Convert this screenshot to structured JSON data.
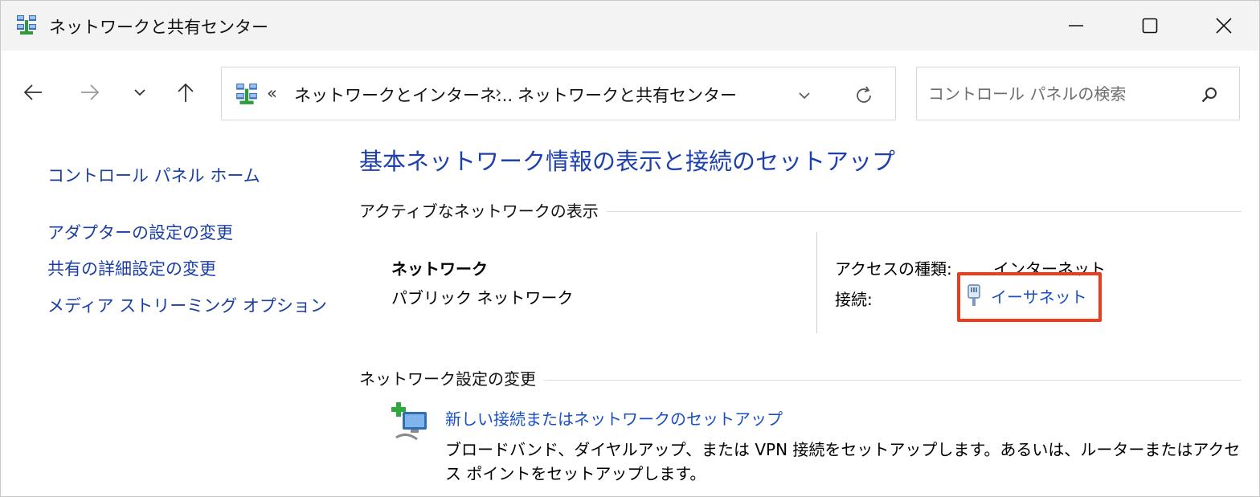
{
  "window": {
    "title": "ネットワークと共有センター",
    "icon": "network-center-icon"
  },
  "nav": {
    "back_icon": "arrow-left-icon",
    "forward_icon": "arrow-right-icon",
    "recent_icon": "chevron-down-icon",
    "up_icon": "arrow-up-icon"
  },
  "address": {
    "overflow": "«",
    "crumbs": [
      "ネットワークとインターネ...",
      "ネットワークと共有センター"
    ],
    "separator": "›"
  },
  "search": {
    "placeholder": "コントロール パネルの検索",
    "value": ""
  },
  "sidebar": {
    "home": "コントロール パネル ホーム",
    "items": [
      {
        "label": "アダプターの設定の変更"
      },
      {
        "label": "共有の詳細設定の変更"
      },
      {
        "label": "メディア ストリーミング オプション"
      }
    ]
  },
  "main": {
    "title": "基本ネットワーク情報の表示と接続のセットアップ",
    "active_section": "アクティブなネットワークの表示",
    "network": {
      "name": "ネットワーク",
      "type": "パブリック ネットワーク",
      "access_label": "アクセスの種類:",
      "access_value": "インターネット",
      "connection_label": "接続:",
      "connection_value": "イーサネット"
    },
    "change_section": "ネットワーク設定の変更",
    "setup": {
      "link": "新しい接続またはネットワークのセットアップ",
      "description": "ブロードバンド、ダイヤルアップ、または VPN 接続をセットアップします。あるいは、ルーターまたはアクセス ポイントをセットアップします。"
    }
  },
  "colors": {
    "link": "#1a4fc4",
    "title": "#1e3fae",
    "highlight": "#ef3a1b"
  }
}
